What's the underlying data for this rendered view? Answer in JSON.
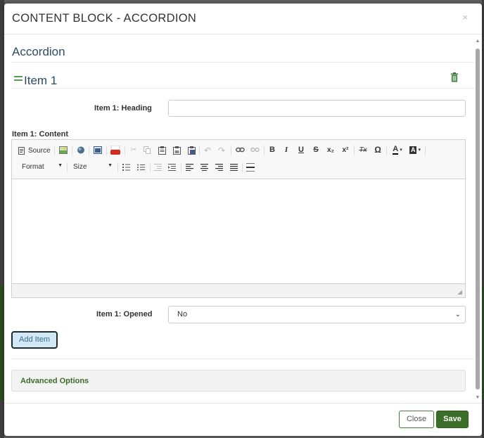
{
  "modal": {
    "title": "CONTENT BLOCK - ACCORDION",
    "close_glyph": "×"
  },
  "section": {
    "title": "Accordion"
  },
  "item": {
    "title": "Item 1",
    "heading_label": "Item 1: Heading",
    "heading_value": "",
    "content_label": "Item 1: Content",
    "opened_label": "Item 1: Opened",
    "opened_value": "No"
  },
  "toolbar": {
    "source_label": "Source",
    "format_label": "Format",
    "size_label": "Size",
    "bold_glyph": "B",
    "italic_glyph": "I",
    "underline_glyph": "U",
    "strike_glyph": "S",
    "subscript_glyph": "x₂",
    "superscript_glyph": "x²",
    "remove_format_glyph": "Tx",
    "special_char_glyph": "Ω",
    "text_color_glyph": "A",
    "bg_color_glyph": "A"
  },
  "buttons": {
    "add_item": "Add Item",
    "advanced_options": "Advanced Options",
    "close": "Close",
    "save": "Save"
  },
  "colors": {
    "accent_green": "#3b6e28",
    "title_blue": "#2b4d65",
    "add_item_bg": "#d2e8f5"
  }
}
